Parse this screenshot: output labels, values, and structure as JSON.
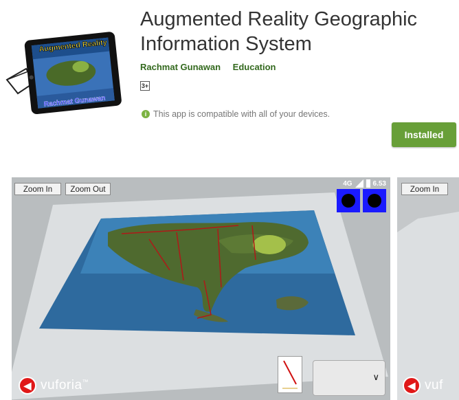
{
  "app": {
    "title": "Augmented Reality Geographic Information System",
    "developer": "Rachmat Gunawan",
    "category": "Education",
    "content_rating": "3+",
    "compat_message": "This app is compatible with all of your devices.",
    "install_label": "Installed",
    "icon_text_top": "Augmented Reality",
    "icon_text_bottom": "Rachmat Gunawan"
  },
  "screenshots": [
    {
      "zoom_in": "Zoom In",
      "zoom_out": "Zoom Out",
      "status_network": "4G",
      "status_time": "6.53",
      "brand": "vuforia",
      "brand_mark": "™"
    },
    {
      "zoom_in": "Zoom In",
      "brand": "vuf"
    }
  ],
  "colors": {
    "brand_green": "#689f38",
    "link_green": "#33691e",
    "puzzle_blue": "#1a1aff",
    "back_red": "#e01818"
  }
}
